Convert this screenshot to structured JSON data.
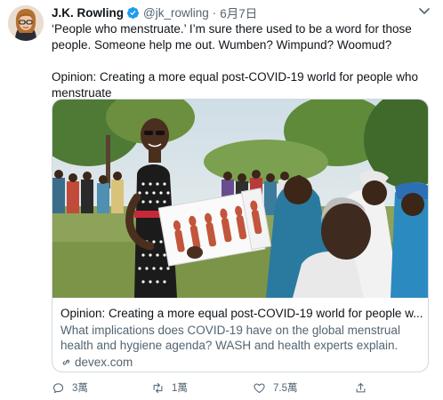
{
  "author": {
    "name": "J.K. Rowling",
    "handle": "@jk_rowling",
    "separator": "·",
    "date": "6月7日"
  },
  "tweet": {
    "line1": "‘People who menstruate.’ I’m sure there used to be a word for those people. Someone help me out. Wumben? Wimpund? Woomud?",
    "line2": "Opinion: Creating a more equal post-COVID-19 world for people who menstruate"
  },
  "card": {
    "title": "Opinion: Creating a more equal post-COVID-19 world for people w...",
    "description": "What implications does COVID-19 have on the global menstrual health and hygiene agenda? WASH and health experts explain.",
    "domain": "devex.com"
  },
  "actions": {
    "reply_count": "3萬",
    "retweet_count": "1萬",
    "like_count": "7.5萬"
  },
  "colors": {
    "text": "#0f1419",
    "muted": "#536471",
    "verified": "#1d9bf0",
    "border": "#cfd9de"
  }
}
